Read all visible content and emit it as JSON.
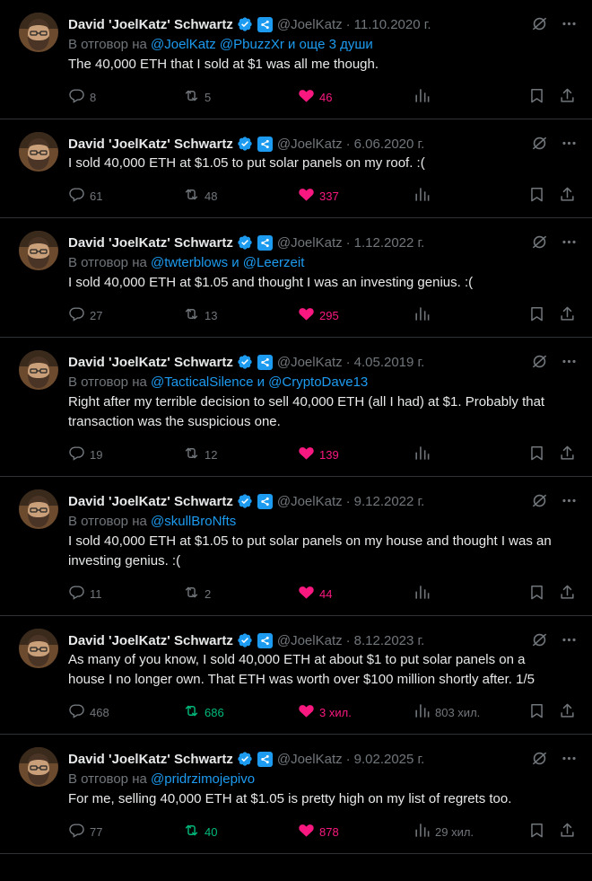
{
  "author": {
    "name": "David 'JoelKatz' Schwartz",
    "handle": "@JoelKatz",
    "separator": "·"
  },
  "colors": {
    "link": "#1d9bf0",
    "like": "#f91880",
    "retweet_active": "#00ba7c",
    "muted": "#71767b",
    "text": "#e7e9ea",
    "border": "#2f3336"
  },
  "icons": {
    "header": [
      "grok-icon",
      "more-icon"
    ],
    "actions": [
      "reply-icon",
      "retweet-icon",
      "like-icon",
      "views-icon",
      "bookmark-icon",
      "share-icon"
    ]
  },
  "tweets": [
    {
      "date": "11.10.2020 г.",
      "reply_prefix": "В отговор на",
      "reply_mentions": "@JoelKatz @PbuzzXr и още 3 души",
      "text": "The 40,000 ETH that I sold at $1 was all me though.",
      "replies": "8",
      "retweets": "5",
      "likes": "46",
      "views": "",
      "retweet_active": false
    },
    {
      "date": "6.06.2020 г.",
      "reply_prefix": "",
      "reply_mentions": "",
      "text": "I sold 40,000 ETH at $1.05 to put solar panels on my roof. :(",
      "replies": "61",
      "retweets": "48",
      "likes": "337",
      "views": "",
      "retweet_active": false
    },
    {
      "date": "1.12.2022 г.",
      "reply_prefix": "В отговор на",
      "reply_mentions": "@twterblows и @Leerzeit",
      "text": "I sold 40,000 ETH at $1.05 and thought I was an investing genius. :(",
      "replies": "27",
      "retweets": "13",
      "likes": "295",
      "views": "",
      "retweet_active": false
    },
    {
      "date": "4.05.2019 г.",
      "reply_prefix": "В отговор на",
      "reply_mentions": "@TacticalSilence и @CryptoDave13",
      "text": "Right after my terrible decision to sell 40,000 ETH (all I had) at $1. Probably that transaction was the suspicious one.",
      "replies": "19",
      "retweets": "12",
      "likes": "139",
      "views": "",
      "retweet_active": false
    },
    {
      "date": "9.12.2022 г.",
      "reply_prefix": "В отговор на",
      "reply_mentions": "@skullBroNfts",
      "text": "I sold 40,000 ETH at $1.05 to put solar panels on my house and thought I was an investing genius. :(",
      "replies": "11",
      "retweets": "2",
      "likes": "44",
      "views": "",
      "retweet_active": false
    },
    {
      "date": "8.12.2023 г.",
      "reply_prefix": "",
      "reply_mentions": "",
      "text": "As many of you know, I sold 40,000 ETH at about $1 to put solar panels on a house I no longer own. That ETH was worth over $100 million shortly after. 1/5",
      "replies": "468",
      "retweets": "686",
      "likes": "3 хил.",
      "views": "803 хил.",
      "retweet_active": true
    },
    {
      "date": "9.02.2025 г.",
      "reply_prefix": "В отговор на",
      "reply_mentions": "@pridrzimojepivo",
      "text": "For me, selling 40,000 ETH at $1.05 is pretty high on my list of regrets too.",
      "replies": "77",
      "retweets": "40",
      "likes": "878",
      "views": "29 хил.",
      "retweet_active": true
    }
  ]
}
